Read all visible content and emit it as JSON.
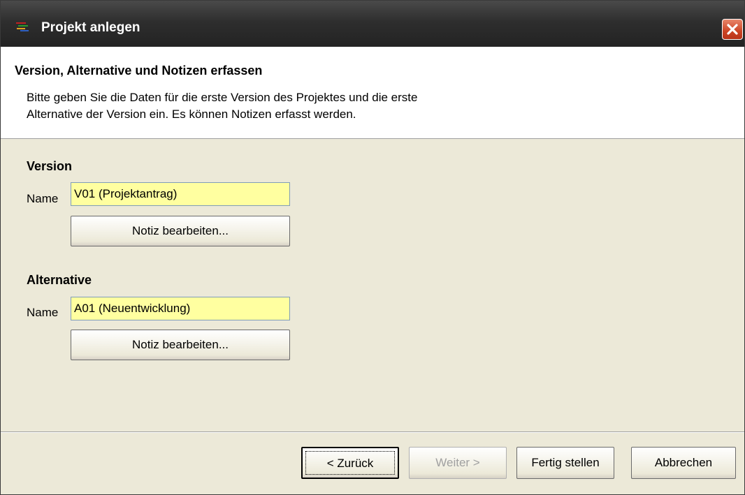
{
  "window": {
    "title": "Projekt anlegen"
  },
  "header": {
    "title": "Version, Alternative und Notizen erfassen",
    "description": "Bitte geben Sie die Daten für die erste Version des Projektes und die erste\nAlternative der Version ein. Es können Notizen erfasst werden."
  },
  "version": {
    "section_title": "Version",
    "name_label": "Name",
    "name_value": "V01 (Projektantrag)",
    "note_button": "Notiz bearbeiten..."
  },
  "alternative": {
    "section_title": "Alternative",
    "name_label": "Name",
    "name_value": "A01 (Neuentwicklung)",
    "note_button": "Notiz bearbeiten..."
  },
  "footer": {
    "back_button": "< Zurück",
    "next_button": "Weiter >",
    "finish_button": "Fertig stellen",
    "cancel_button": "Abbrechen"
  },
  "colors": {
    "input_highlight": "#ffffa0",
    "titlebar": "#2e2e2e",
    "close_button": "#cc4424",
    "dialog_background": "#ece9d8"
  }
}
